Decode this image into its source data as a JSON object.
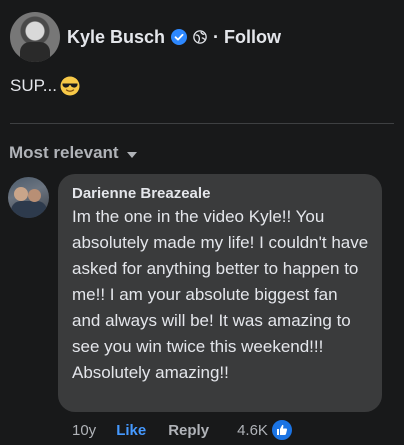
{
  "post": {
    "author": "Kyle Busch",
    "follow_label": "· Follow",
    "text": "SUP...",
    "emoji": "smiling-face-with-sunglasses"
  },
  "comments": {
    "sort_label": "Most relevant",
    "items": [
      {
        "author": "Darienne Breazeale",
        "text": "Im the one in the video Kyle!! You absolutely made my life! I couldn't have asked for anything better to happen to me!! I am your absolute biggest fan and always will be! It was amazing to see you win twice this weekend!!! Absolutely amazing!!",
        "time": "10y",
        "like_label": "Like",
        "reply_label": "Reply",
        "reaction_count": "4.6K"
      }
    ]
  },
  "colors": {
    "background": "#18191a",
    "bubble": "#3a3b3c",
    "accent": "#4599ff",
    "secondary_text": "#b0b3b8"
  }
}
